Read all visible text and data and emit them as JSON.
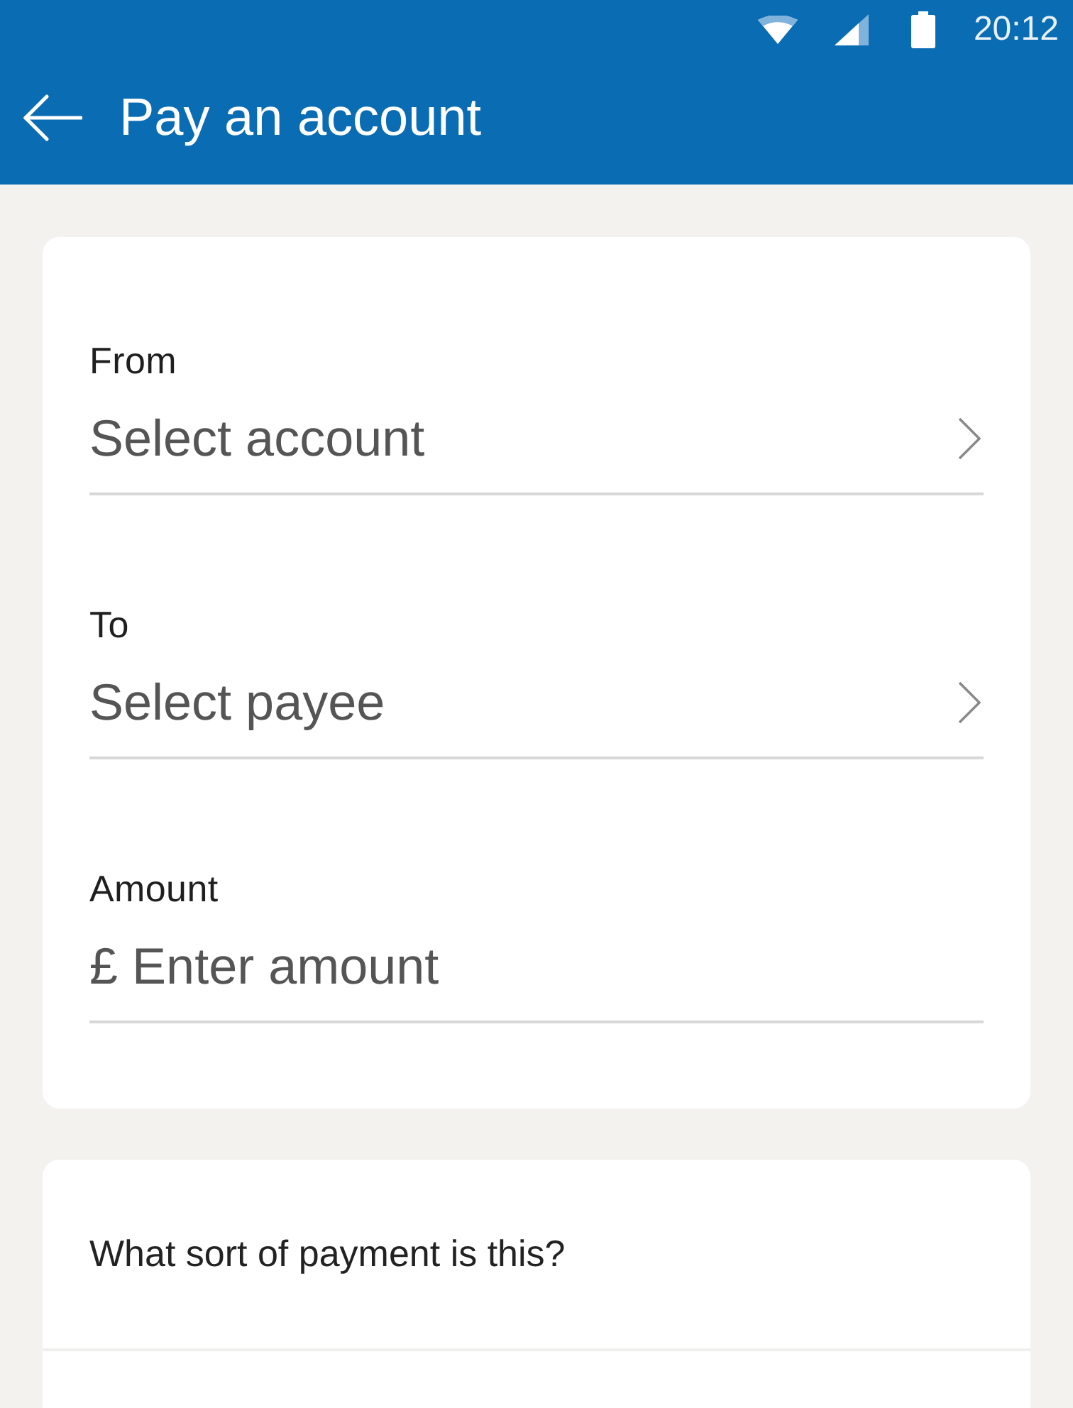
{
  "status_bar": {
    "time": "20:12"
  },
  "app_bar": {
    "title": "Pay an account"
  },
  "form": {
    "fields": [
      {
        "kind": "select",
        "label": "From",
        "placeholder": "Select account"
      },
      {
        "kind": "select",
        "label": "To",
        "placeholder": "Select payee"
      },
      {
        "kind": "amount",
        "label": "Amount",
        "currency": "£",
        "placeholder": "Enter amount"
      }
    ]
  },
  "payment_type": {
    "question": "What sort of payment is this?"
  }
}
